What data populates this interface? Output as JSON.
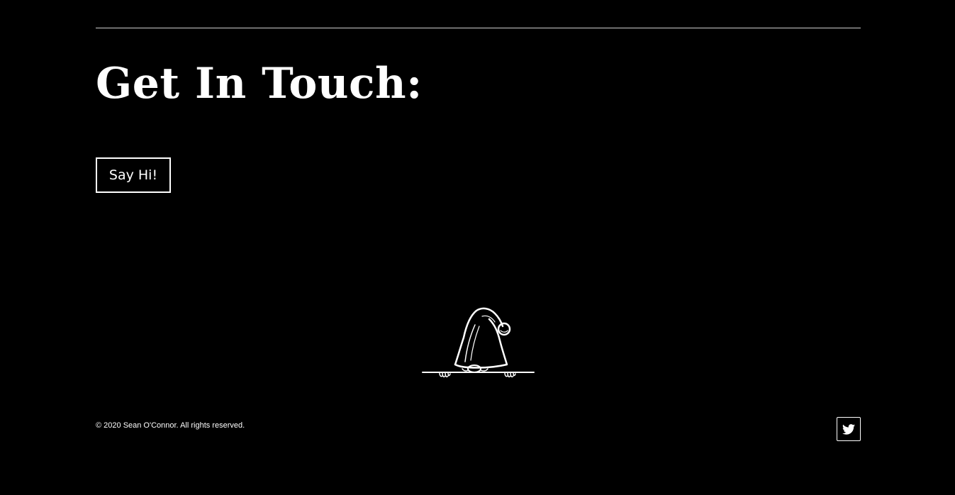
{
  "contact": {
    "heading": "Get In Touch:",
    "button_label": "Say Hi!"
  },
  "illustration": {
    "icon": "peeking-gnome-icon"
  },
  "footer": {
    "copyright": "© 2020 Sean O'Connor. All rights reserved.",
    "social": [
      {
        "icon": "twitter-icon"
      }
    ]
  },
  "colors": {
    "background": "#000000",
    "foreground": "#ffffff",
    "rule": "#cfcfcf"
  }
}
